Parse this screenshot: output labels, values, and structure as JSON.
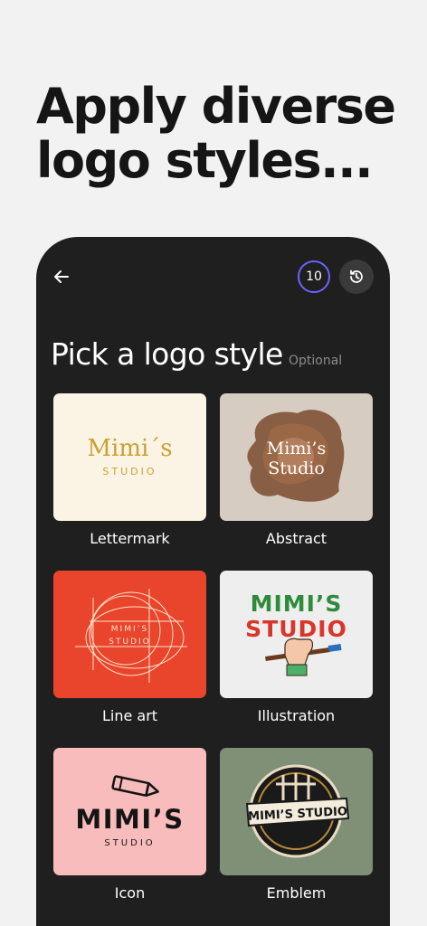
{
  "headline": "Apply diverse logo styles...",
  "header": {
    "credits": "10",
    "back_icon": "arrow-left-icon",
    "history_icon": "history-icon"
  },
  "section": {
    "title": "Pick a logo style",
    "optional": "Optional"
  },
  "styles": [
    {
      "label": "Lettermark",
      "logo_main": "Mimi´s",
      "logo_sub": "STUDIO"
    },
    {
      "label": "Abstract",
      "logo_line1": "Mimi’s",
      "logo_line2": "Studio"
    },
    {
      "label": "Line art",
      "logo_line1": "MIMI’S",
      "logo_line2": "STUDIO"
    },
    {
      "label": "Illustration",
      "logo_line1": "MIMI’S",
      "logo_line2": "STUDIO"
    },
    {
      "label": "Icon",
      "logo_main": "MIMI’S",
      "logo_sub": "STUDIO"
    },
    {
      "label": "Emblem",
      "logo_main": "MIMI’S STUDIO"
    }
  ],
  "colors": {
    "accent": "#6c63ff",
    "phone_bg": "#1f1f1f",
    "page_bg": "#f2f2f3"
  }
}
